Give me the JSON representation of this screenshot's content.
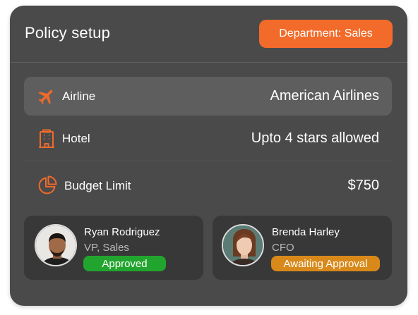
{
  "header": {
    "title": "Policy setup",
    "department_button": "Department: Sales"
  },
  "policies": [
    {
      "icon": "airplane-icon",
      "label": "Airline",
      "value": "American Airlines",
      "highlighted": true
    },
    {
      "icon": "hotel-icon",
      "label": "Hotel",
      "value": "Upto 4 stars allowed",
      "highlighted": false
    },
    {
      "icon": "pie-chart-icon",
      "label": "Budget Limit",
      "value": "$750",
      "highlighted": false
    }
  ],
  "approvers": [
    {
      "name": "Ryan Rodriguez",
      "role": "VP, Sales",
      "status": "Approved",
      "status_color": "#22a52e"
    },
    {
      "name": "Brenda Harley",
      "role": "CFO",
      "status": "Awaiting Approval",
      "status_color": "#d8891a"
    }
  ],
  "colors": {
    "accent": "#f26b2a",
    "card_bg": "#4a4a4a",
    "highlight_row": "#5e5e5e",
    "person_card_bg": "#383838",
    "icon_orange": "#f06a2a"
  }
}
